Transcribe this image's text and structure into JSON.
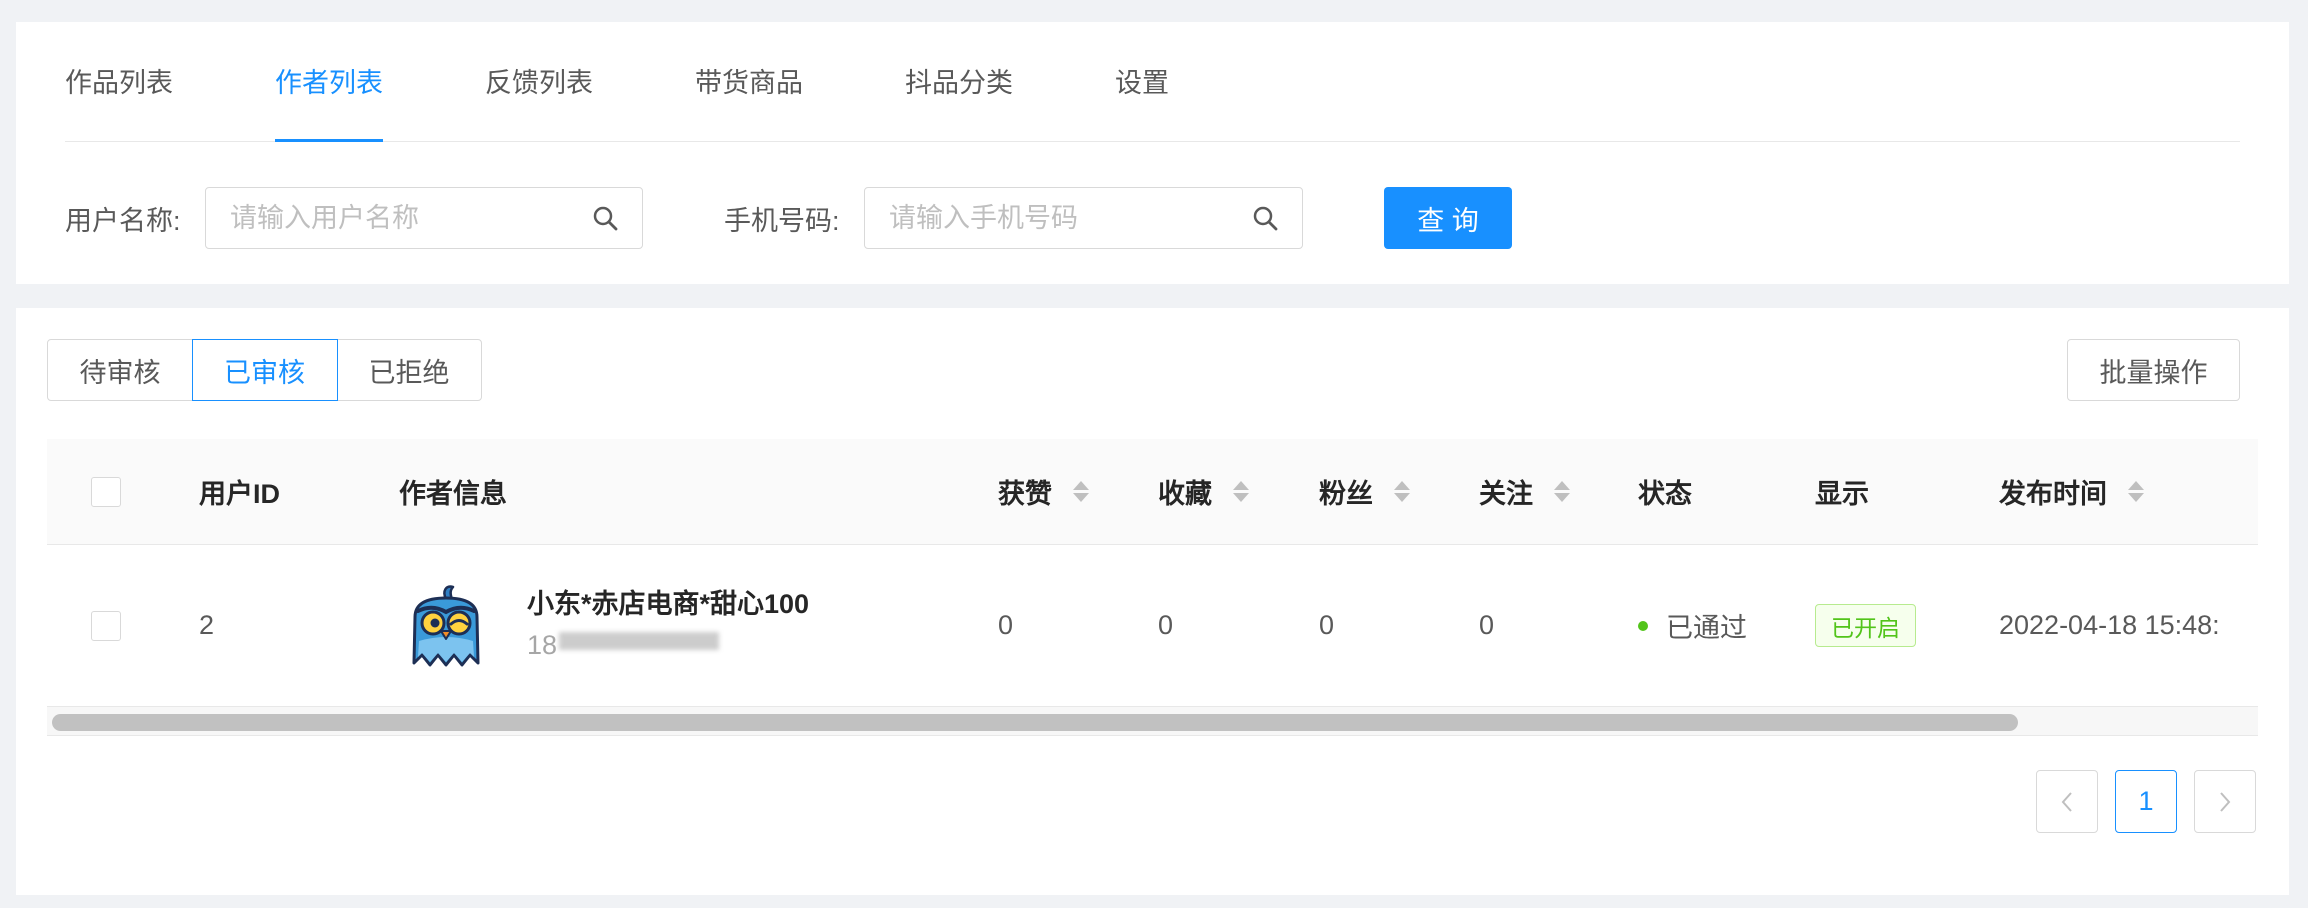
{
  "nav_tabs": {
    "items": [
      {
        "label": "作品列表",
        "active": false
      },
      {
        "label": "作者列表",
        "active": true
      },
      {
        "label": "反馈列表",
        "active": false
      },
      {
        "label": "带货商品",
        "active": false
      },
      {
        "label": "抖品分类",
        "active": false
      },
      {
        "label": "设置",
        "active": false
      }
    ]
  },
  "filters": {
    "username": {
      "label": "用户名称:",
      "placeholder": "请输入用户名称",
      "value": "",
      "icon": "search-icon"
    },
    "phone": {
      "label": "手机号码:",
      "placeholder": "请输入手机号码",
      "value": "",
      "icon": "search-icon"
    },
    "query_button": "查 询"
  },
  "status_tabs": {
    "items": [
      {
        "label": "待审核",
        "active": false
      },
      {
        "label": "已审核",
        "active": true
      },
      {
        "label": "已拒绝",
        "active": false
      }
    ]
  },
  "batch_button": "批量操作",
  "table": {
    "columns": [
      {
        "label": "用户ID",
        "sortable": false
      },
      {
        "label": "作者信息",
        "sortable": false
      },
      {
        "label": "获赞",
        "sortable": true
      },
      {
        "label": "收藏",
        "sortable": true
      },
      {
        "label": "粉丝",
        "sortable": true
      },
      {
        "label": "关注",
        "sortable": true
      },
      {
        "label": "状态",
        "sortable": false
      },
      {
        "label": "显示",
        "sortable": false
      },
      {
        "label": "发布时间",
        "sortable": true
      }
    ],
    "rows": [
      {
        "checked": false,
        "user_id": "2",
        "avatar_icon": "owl-avatar-icon",
        "name": "小东*赤店电商*甜心100",
        "phone_visible": "18",
        "likes": "0",
        "favorites": "0",
        "fans": "0",
        "follows": "0",
        "status": "已通过",
        "display_tag": "已开启",
        "publish_time": "2022-04-18 15:48:"
      }
    ]
  },
  "pagination": {
    "current_page": "1",
    "prev_icon": "chevron-left-icon",
    "next_icon": "chevron-right-icon"
  },
  "colors": {
    "primary": "#1890ff",
    "success": "#52c41a",
    "page_background": "#f0f2f5"
  }
}
